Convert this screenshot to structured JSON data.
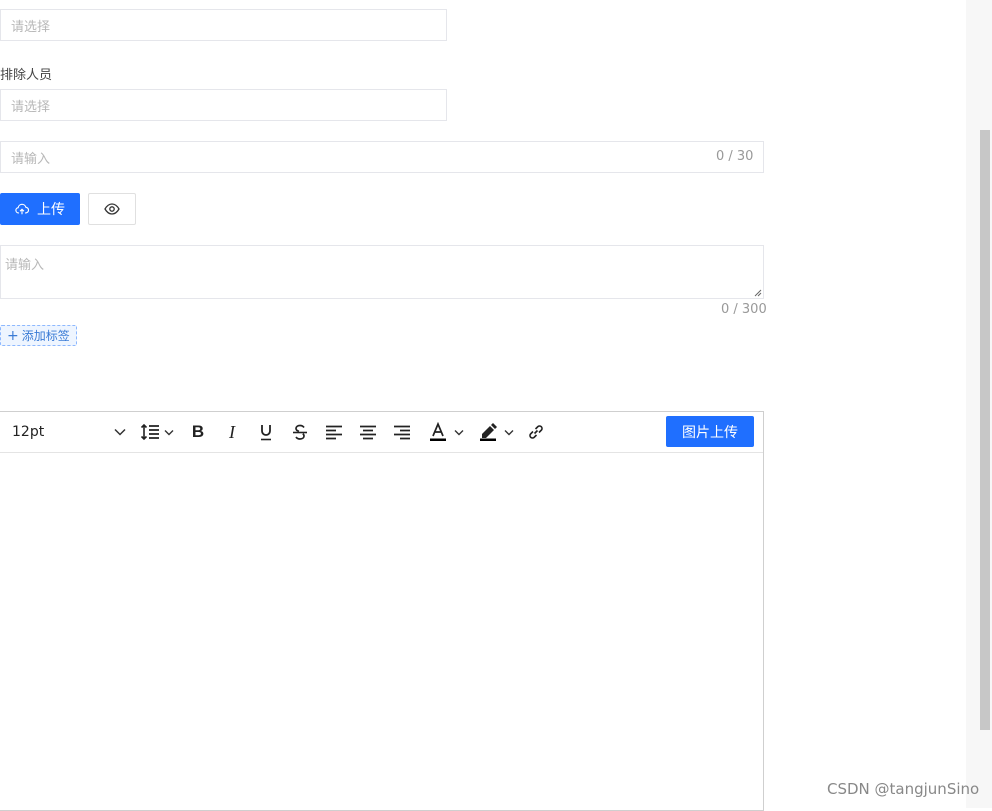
{
  "form": {
    "select_placeholder_1": "请选择",
    "exclude_label": "排除人员",
    "select_placeholder_2": "请选择",
    "input_placeholder": "请输入",
    "input_counter": "0 / 30",
    "upload_label": "上传",
    "textarea_placeholder": "请输入",
    "textarea_counter": "0 / 300",
    "add_tag_label": "添加标签"
  },
  "editor": {
    "font_size": "12pt",
    "image_upload_label": "图片上传"
  },
  "colors": {
    "primary": "#1f6fff"
  },
  "watermark": "CSDN @tangjunSino"
}
